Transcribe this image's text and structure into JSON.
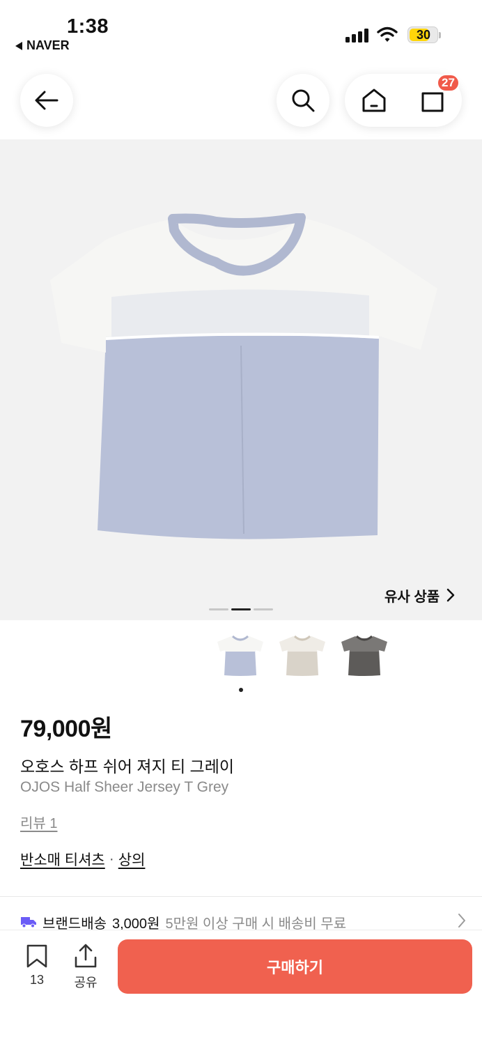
{
  "status_bar": {
    "time": "1:38",
    "back_app_label": "NAVER",
    "battery_level": "30"
  },
  "nav": {
    "back_icon": "arrow-left-icon",
    "search_icon": "search-icon",
    "home_icon": "home-icon",
    "cart_icon": "shopping-bag-icon",
    "cart_count": "27"
  },
  "gallery": {
    "similar_label": "유사 상품",
    "page_count": 3,
    "active_page": 2,
    "thumbnail_colors": [
      "grey",
      "beige",
      "charcoal"
    ]
  },
  "product": {
    "price": "79,000원",
    "name_ko": "오호스 하프 쉬어 져지 티 그레이",
    "name_en": "OJOS Half Sheer Jersey T Grey",
    "review_label": "리뷰 1",
    "category_1": "반소매 티셔츠",
    "category_sep": "·",
    "category_2": "상의"
  },
  "shipping": {
    "type": "브랜드배송",
    "fee": "3,000원",
    "condition": "5만원 이상 구매 시 배송비 무료"
  },
  "bottom_bar": {
    "save_count": "13",
    "share_label": "공유",
    "buy_label": "구매하기"
  },
  "colors": {
    "accent": "#f0614f",
    "badge": "#f05a4a",
    "battery": "#ffd60a",
    "shipping_icon": "#6b5cf6",
    "shirt_body": "#b8c0d8",
    "shirt_sheer": "#f6f6f4"
  }
}
